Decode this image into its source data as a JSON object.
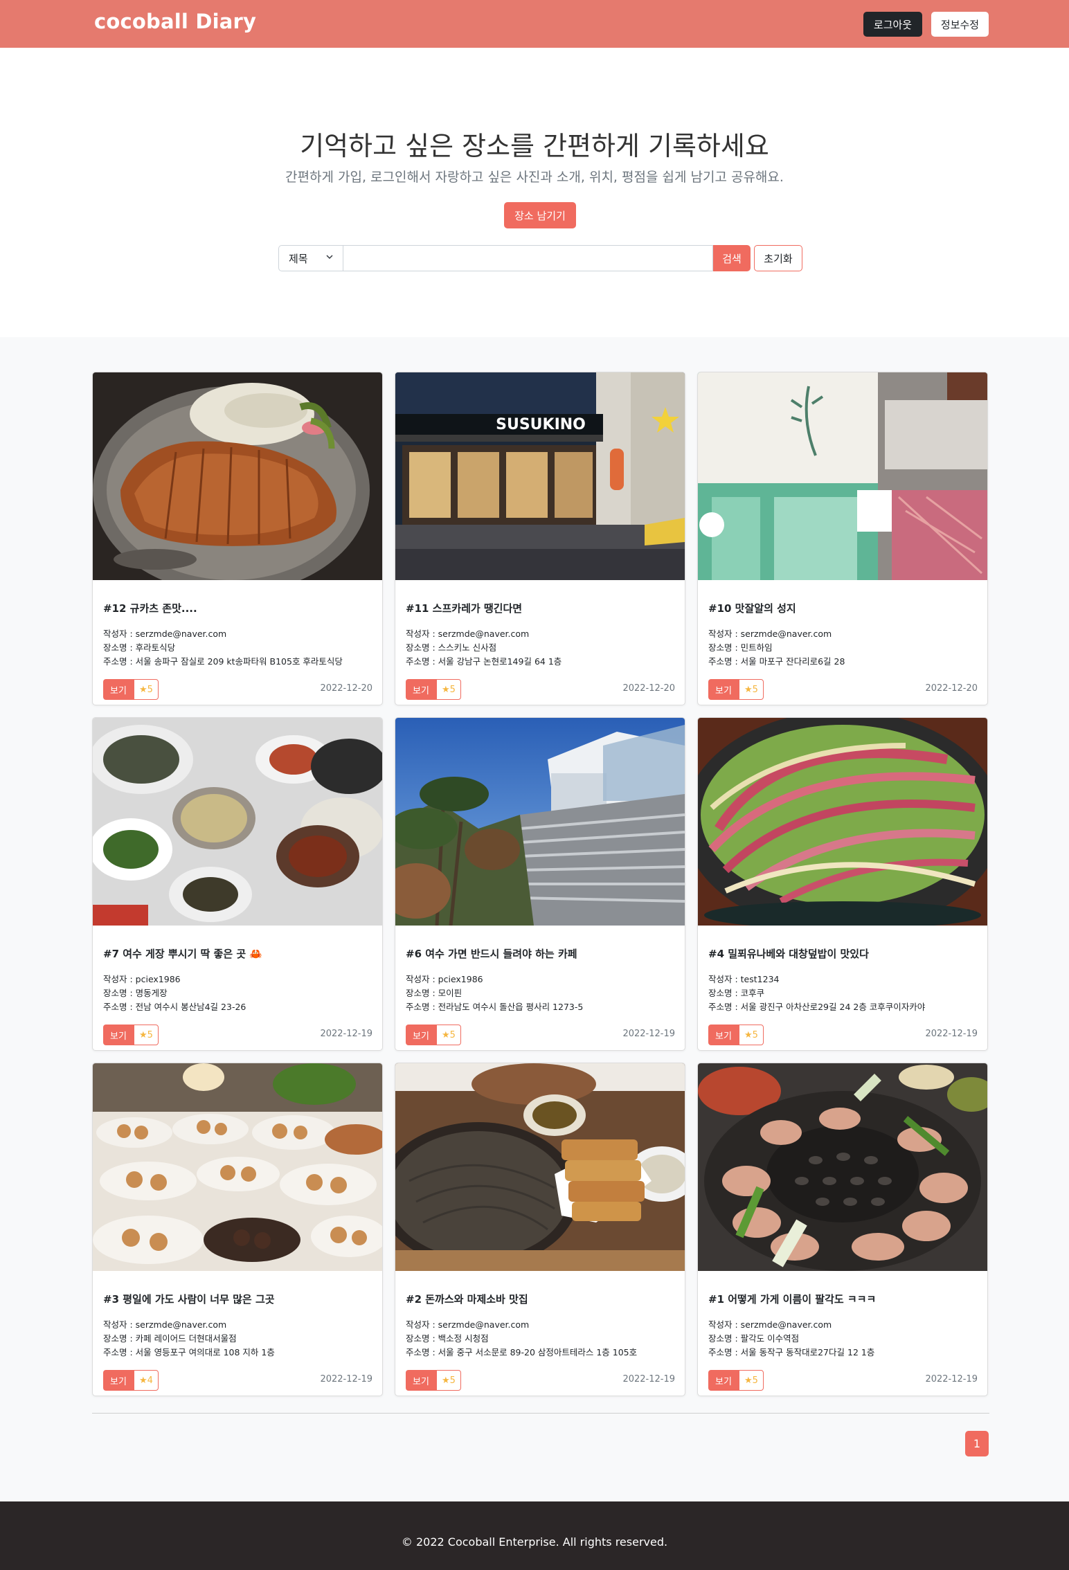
{
  "navbar": {
    "brand": "cocoball Diary",
    "logout_label": "로그아웃",
    "edit_label": "정보수정",
    "bg_color": "#e57a6e"
  },
  "hero": {
    "title": "기억하고 싶은 장소를 간편하게 기록하세요",
    "subtitle": "간편하게 가입, 로그인해서 자랑하고 싶은 사진과 소개, 위치, 평점을 쉽게 남기고 공유해요.",
    "cta_label": "장소 남기기"
  },
  "search": {
    "selected_option": "제목",
    "value": "",
    "placeholder": "",
    "submit_label": "검색",
    "reset_label": "초기화"
  },
  "cards": [
    {
      "title": "#12 규카츠 존맛....",
      "author": "작성자 : serzmde@naver.com",
      "place": "장소명 : 후라토식당",
      "address": "주소명 : 서울 송파구 잠실로 209 kt송파타워 B105호 후라토식당",
      "view_label": "보기",
      "rating": "★5",
      "date": "2022-12-20",
      "photo": "tonkatsu"
    },
    {
      "title": "#11 스프카레가 땡긴다면",
      "author": "작성자 : serzmde@naver.com",
      "place": "장소명 : 스스키노 신사점",
      "address": "주소명 : 서울 강남구 논현로149길 64 1층",
      "view_label": "보기",
      "rating": "★5",
      "date": "2022-12-20",
      "photo": "storefront-susukino"
    },
    {
      "title": "#10 맛잘알의 성지",
      "author": "작성자 : serzmde@naver.com",
      "place": "장소명 : 민트하임",
      "address": "주소명 : 서울 마포구 잔다리로6길 28",
      "view_label": "보기",
      "rating": "★5",
      "date": "2022-12-20",
      "photo": "mint-storefront"
    },
    {
      "title": "#7 여수 게장 뿌시기 딱 좋은 곳 🦀",
      "author": "작성자 : pciex1986",
      "place": "장소명 : 명동게장",
      "address": "주소명 : 전남 여수시 봉산남4길 23-26",
      "view_label": "보기",
      "rating": "★5",
      "date": "2022-12-19",
      "photo": "korean-banchan"
    },
    {
      "title": "#6 여수 가면 반드시 들려야 하는 카페",
      "author": "작성자 : pciex1986",
      "place": "장소명 : 모이핀",
      "address": "주소명 : 전라남도 여수시 돌산읍 평사리 1273-5",
      "view_label": "보기",
      "rating": "★5",
      "date": "2022-12-19",
      "photo": "hill-cafe"
    },
    {
      "title": "#4 밀푀유나베와 대창덮밥이 맛있다",
      "author": "작성자 : test1234",
      "place": "장소명 : 코후쿠",
      "address": "주소명 : 서울 광진구 아차산로29길 24 2층 코후쿠이자카야",
      "view_label": "보기",
      "rating": "★5",
      "date": "2022-12-19",
      "photo": "millefeuille-nabe"
    },
    {
      "title": "#3 평일에 가도 사람이 너무 많은 그곳",
      "author": "작성자 : serzmde@naver.com",
      "place": "장소명 : 카페 레이어드 더현대서울점",
      "address": "주소명 : 서울 영등포구 여의대로 108 지하 1층",
      "view_label": "보기",
      "rating": "★4",
      "date": "2022-12-19",
      "photo": "bakery"
    },
    {
      "title": "#2 돈까스와 마제소바 맛집",
      "author": "작성자 : serzmde@naver.com",
      "place": "장소명 : 백소정 시청점",
      "address": "주소명 : 서울 중구 서소문로 89-20 삼정아트테라스 1층 105호",
      "view_label": "보기",
      "rating": "★5",
      "date": "2022-12-19",
      "photo": "soba-katsu"
    },
    {
      "title": "#1 어떻게 가게 이름이 팔각도 ㅋㅋㅋ",
      "author": "작성자 : serzmde@naver.com",
      "place": "장소명 : 팔각도 이수역점",
      "address": "주소명 : 서울 동작구 동작대로27다길 12 1층",
      "view_label": "보기",
      "rating": "★5",
      "date": "2022-12-19",
      "photo": "bbq-grill"
    }
  ],
  "pagination": {
    "current": "1"
  },
  "footer": {
    "text": "© 2022 Cocoball Enterprise. All rights reserved."
  },
  "colors": {
    "accent": "#f06b5f",
    "star": "#f5b640",
    "footer_bg": "#2b2627"
  }
}
